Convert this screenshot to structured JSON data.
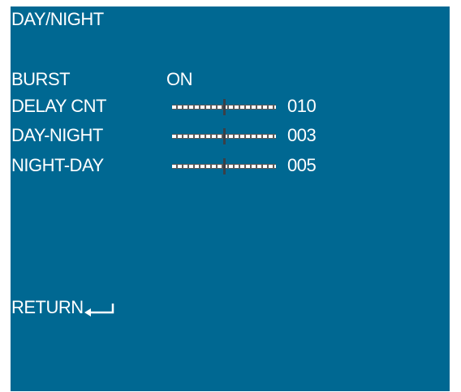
{
  "menu": {
    "title": "DAY/NIGHT",
    "burst": {
      "label": "BURST",
      "value": "ON"
    },
    "delay_cnt": {
      "label": "DELAY CNT",
      "value": "010",
      "level": 0.5
    },
    "day_night": {
      "label": "DAY-NIGHT",
      "value": "003",
      "level": 0.5
    },
    "night_day": {
      "label": "NIGHT-DAY",
      "value": "005",
      "level": 0.5
    },
    "return": {
      "label": "RETURN",
      "icon": "enter-arrow-icon"
    }
  },
  "colors": {
    "background": "#006892",
    "text": "#ffffff",
    "knob": "#3a4048"
  }
}
